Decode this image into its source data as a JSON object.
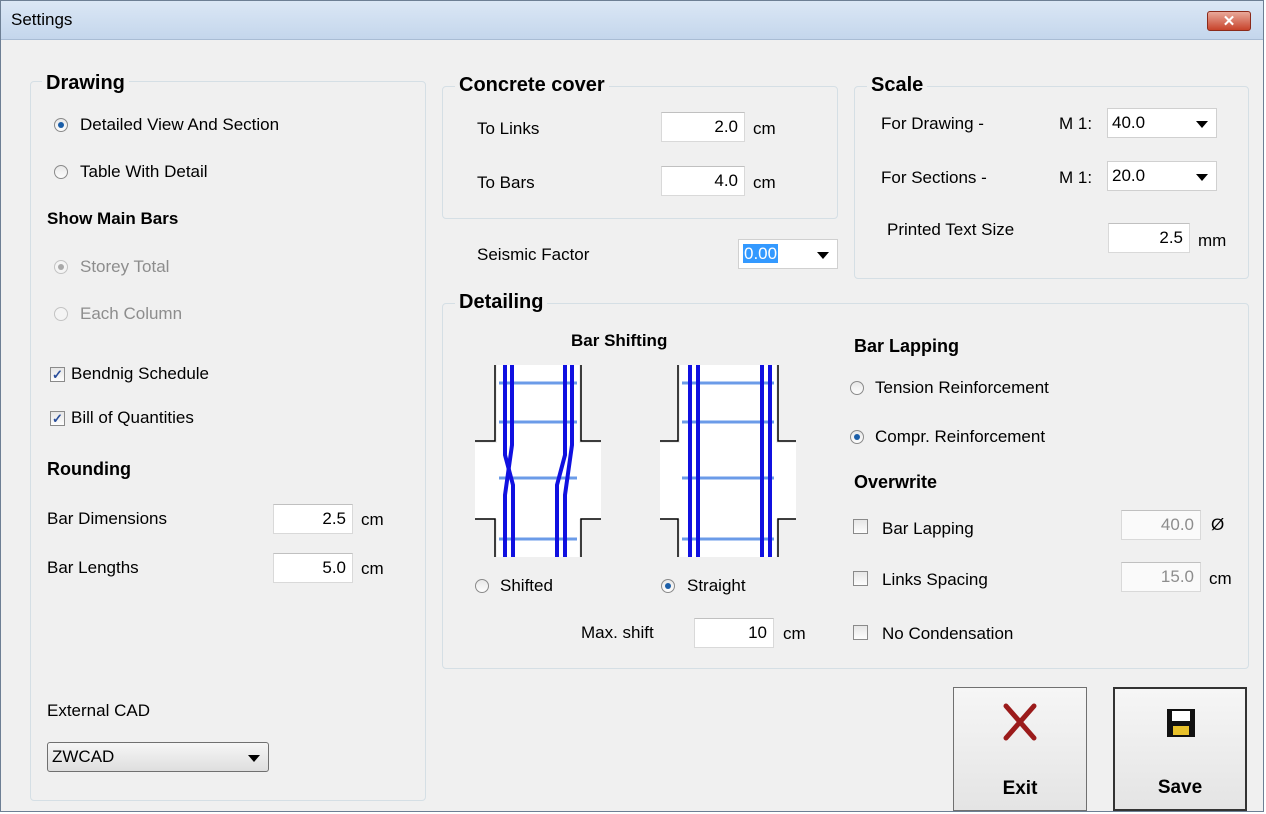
{
  "window": {
    "title": "Settings",
    "close_label": "✕"
  },
  "drawing": {
    "title": "Drawing",
    "options": [
      "Detailed View And Section",
      "Table With Detail"
    ],
    "selected": 0,
    "show_main_bars_label": "Show Main Bars",
    "main_bars_options": [
      "Storey Total",
      "Each Column"
    ],
    "bending_schedule": {
      "label": "Bendnig Schedule",
      "checked": true
    },
    "bill_of_quantities": {
      "label": "Bill of Quantities",
      "checked": true
    },
    "rounding_label": "Rounding",
    "bar_dimensions": {
      "label": "Bar Dimensions",
      "value": "2.5",
      "unit": "cm"
    },
    "bar_lengths": {
      "label": "Bar Lengths",
      "value": "5.0",
      "unit": "cm"
    },
    "external_cad_label": "External CAD",
    "external_cad_value": "ZWCAD"
  },
  "concrete_cover": {
    "title": "Concrete cover",
    "to_links": {
      "label": "To Links",
      "value": "2.0",
      "unit": "cm"
    },
    "to_bars": {
      "label": "To Bars",
      "value": "4.0",
      "unit": "cm"
    }
  },
  "seismic": {
    "label": "Seismic Factor",
    "value": "0.00"
  },
  "scale": {
    "title": "Scale",
    "for_drawing": {
      "label": "For Drawing -",
      "prefix": "M 1:",
      "value": "40.0"
    },
    "for_sections": {
      "label": "For Sections -",
      "prefix": "M 1:",
      "value": "20.0"
    },
    "printed_text_size": {
      "label": "Printed Text Size",
      "value": "2.5",
      "unit": "mm"
    }
  },
  "detailing": {
    "title": "Detailing",
    "bar_shifting_label": "Bar Shifting",
    "shifted_label": "Shifted",
    "straight_label": "Straight",
    "max_shift": {
      "label": "Max. shift",
      "value": "10",
      "unit": "cm"
    },
    "bar_lapping_label": "Bar Lapping",
    "tension_label": "Tension Reinforcement",
    "compr_label": "Compr. Reinforcement",
    "overwrite_label": "Overwrite",
    "ow_bar_lapping": {
      "label": "Bar Lapping",
      "value": "40.0",
      "unit": "Ø"
    },
    "ow_links_spacing": {
      "label": "Links Spacing",
      "value": "15.0",
      "unit": "cm"
    },
    "no_condensation": {
      "label": "No Condensation"
    }
  },
  "buttons": {
    "exit": "Exit",
    "save": "Save"
  },
  "colors": {
    "rebar": "#1010e0",
    "link": "#6b9be8",
    "exit_icon": "#9b1b1b"
  }
}
